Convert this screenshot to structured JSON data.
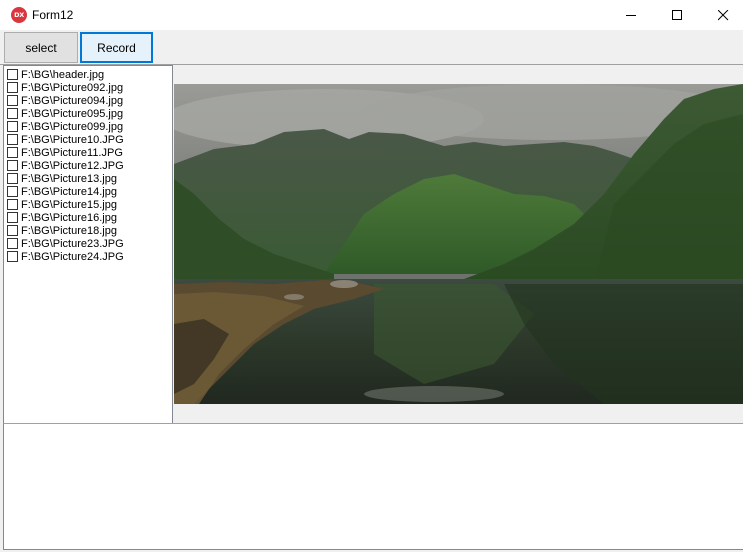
{
  "window": {
    "title": "Form12",
    "app_icon_text": "DX",
    "controls": [
      "minimize-icon",
      "maximize-icon",
      "close-icon"
    ]
  },
  "toolbar": {
    "select_label": "select",
    "record_label": "Record"
  },
  "file_list": {
    "items": [
      {
        "path": "F:\\BG\\header.jpg",
        "checked": false
      },
      {
        "path": "F:\\BG\\Picture092.jpg",
        "checked": false
      },
      {
        "path": "F:\\BG\\Picture094.jpg",
        "checked": false
      },
      {
        "path": "F:\\BG\\Picture095.jpg",
        "checked": false
      },
      {
        "path": "F:\\BG\\Picture099.jpg",
        "checked": false
      },
      {
        "path": "F:\\BG\\Picture10.JPG",
        "checked": false
      },
      {
        "path": "F:\\BG\\Picture11.JPG",
        "checked": false
      },
      {
        "path": "F:\\BG\\Picture12.JPG",
        "checked": false
      },
      {
        "path": "F:\\BG\\Picture13.jpg",
        "checked": false
      },
      {
        "path": "F:\\BG\\Picture14.jpg",
        "checked": false
      },
      {
        "path": "F:\\BG\\Picture15.jpg",
        "checked": false
      },
      {
        "path": "F:\\BG\\Picture16.jpg",
        "checked": false
      },
      {
        "path": "F:\\BG\\Picture18.jpg",
        "checked": false
      },
      {
        "path": "F:\\BG\\Picture23.JPG",
        "checked": false
      },
      {
        "path": "F:\\BG\\Picture24.JPG",
        "checked": false
      }
    ]
  },
  "preview": {
    "subject": "mountain lake landscape photo"
  },
  "colors": {
    "accent": "#0078d7",
    "app_icon": "#d9363e",
    "panel_bg": "#f0f0f0"
  }
}
